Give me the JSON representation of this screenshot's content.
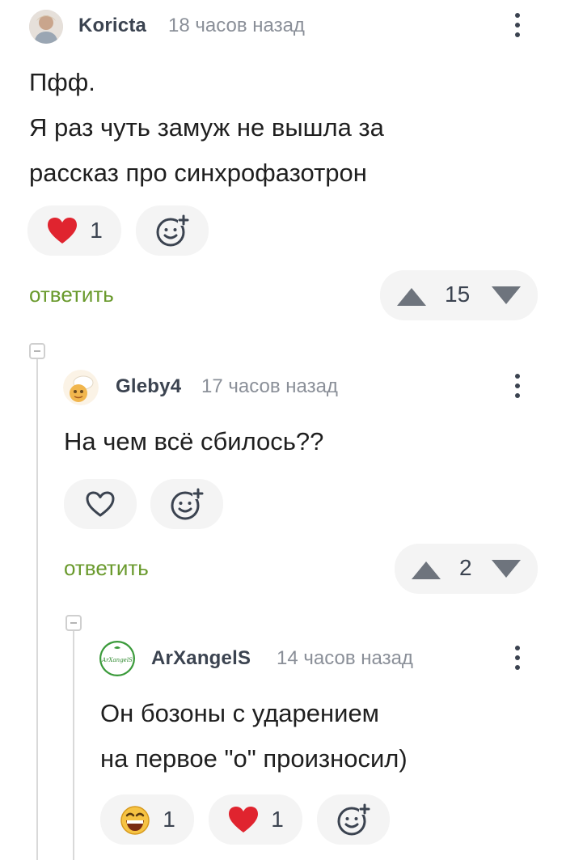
{
  "comments": [
    {
      "username": "Koricta",
      "time": "18 часов назад",
      "lines": [
        "Пфф.",
        "Я раз чуть замуж не вышла за",
        "рассказ про синхрофазотрон"
      ],
      "reactions": [
        {
          "icon": "heart-filled-icon",
          "count": "1"
        }
      ],
      "reply_label": "ответить",
      "rating": "15"
    },
    {
      "username": "Gleby4",
      "time": "17 часов назад",
      "lines": [
        "На чем всё сбилось??"
      ],
      "reactions": [],
      "reply_label": "ответить",
      "rating": "2"
    },
    {
      "username": "ArXangelS",
      "avatar_text": "ArXangelS",
      "time": "14 часов назад",
      "lines": [
        "Он бозоны с ударением",
        "на первое \"о\" произносил)"
      ],
      "reactions": [
        {
          "icon": "grin-emoji-icon",
          "count": "1"
        },
        {
          "icon": "heart-filled-icon",
          "count": "1"
        }
      ]
    }
  ],
  "colors": {
    "accent_green": "#6a9a2d",
    "heart_red": "#e0242f",
    "pill_bg": "#f4f4f4"
  }
}
